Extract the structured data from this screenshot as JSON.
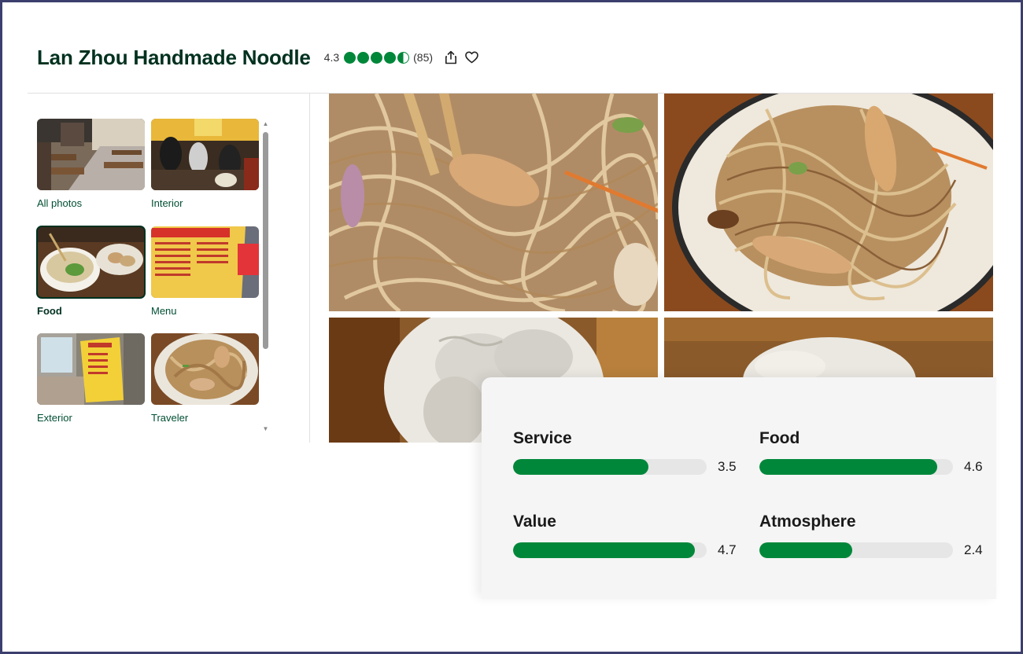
{
  "header": {
    "title": "Lan Zhou Handmade Noodle",
    "rating": "4.3",
    "review_count": "(85)",
    "bubbles_filled": 4.5,
    "share_icon": "share-icon",
    "heart_icon": "heart-icon"
  },
  "categories": [
    {
      "label": "All photos",
      "selected": false
    },
    {
      "label": "Interior",
      "selected": false
    },
    {
      "label": "Food",
      "selected": true
    },
    {
      "label": "Menu",
      "selected": false
    },
    {
      "label": "Exterior",
      "selected": false
    },
    {
      "label": "Traveler",
      "selected": false
    }
  ],
  "ratings": [
    {
      "name": "Service",
      "value": "3.5",
      "fraction": 0.7
    },
    {
      "name": "Food",
      "value": "4.6",
      "fraction": 0.92
    },
    {
      "name": "Value",
      "value": "4.7",
      "fraction": 0.94
    },
    {
      "name": "Atmosphere",
      "value": "2.4",
      "fraction": 0.48
    }
  ],
  "colors": {
    "brand_green": "#00873a",
    "title_dark": "#00311f"
  }
}
